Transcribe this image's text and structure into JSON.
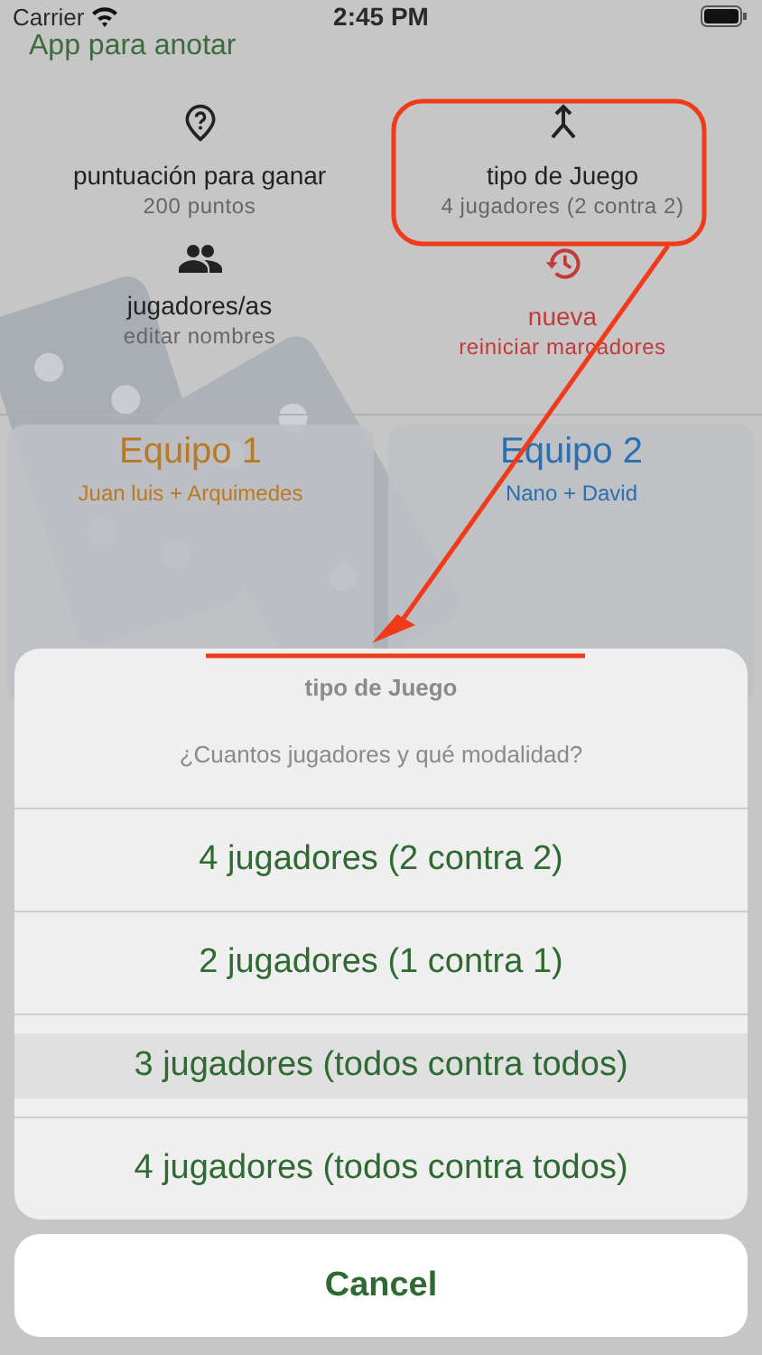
{
  "status_bar": {
    "carrier": "Carrier",
    "time": "2:45 PM"
  },
  "app_title": "App para anotar",
  "menu": [
    {
      "kind": "target",
      "label": "puntuación para ganar",
      "sublabel": "200 puntos",
      "alert": false
    },
    {
      "kind": "merge",
      "label": "tipo de Juego",
      "sublabel": "4 jugadores (2 contra 2)",
      "alert": false
    },
    {
      "kind": "people",
      "label": "jugadores/as",
      "sublabel": "editar nombres",
      "alert": false
    },
    {
      "kind": "history",
      "label": "nueva",
      "sublabel": "reiniciar marcadores",
      "alert": true
    }
  ],
  "teams": [
    {
      "name": "Equipo 1",
      "players": "Juan luis + Arquimedes",
      "color": "#b87a22"
    },
    {
      "name": "Equipo 2",
      "players": "Nano + David",
      "color": "#2a6fb0"
    }
  ],
  "action_sheet": {
    "title": "tipo de Juego",
    "message": "¿Cuantos jugadores y qué modalidad?",
    "options": [
      {
        "label": "4 jugadores (2 contra 2)",
        "selected": false
      },
      {
        "label": "2 jugadores (1 contra 1)",
        "selected": false
      },
      {
        "label": "3 jugadores (todos contra todos)",
        "selected": true
      },
      {
        "label": "4 jugadores (todos contra todos)",
        "selected": false
      }
    ],
    "cancel": "Cancel"
  }
}
